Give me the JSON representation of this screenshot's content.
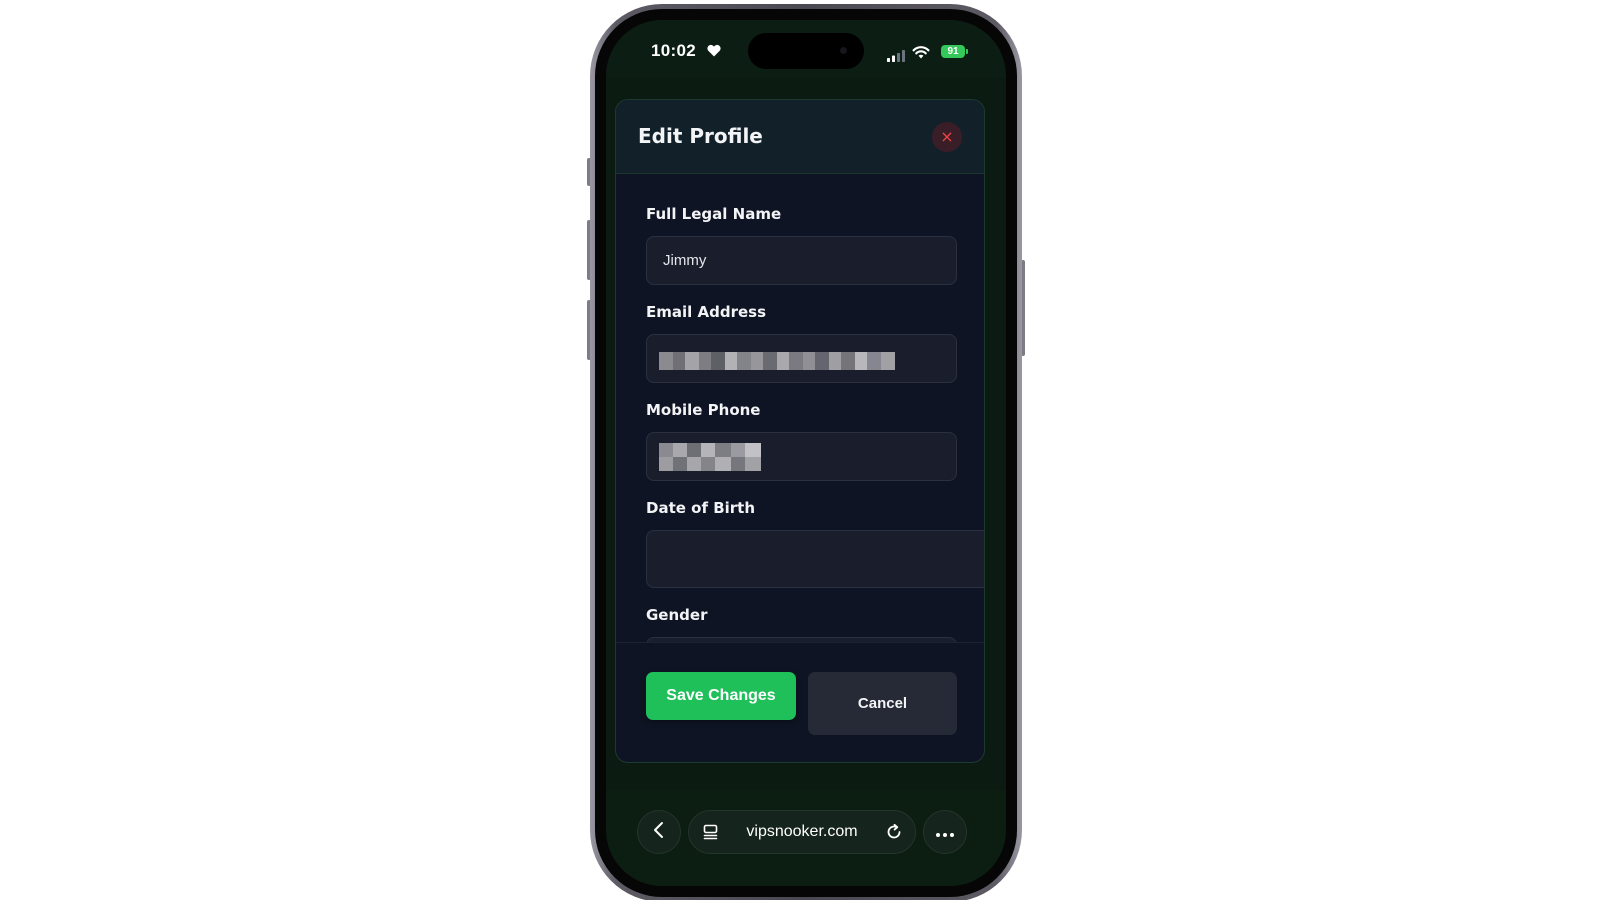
{
  "status_bar": {
    "time": "10:02",
    "battery": "91",
    "icons": [
      "heart-icon",
      "signal-icon",
      "wifi-icon",
      "battery-icon"
    ]
  },
  "modal": {
    "title": "Edit Profile",
    "close_symbol": "×",
    "fields": [
      {
        "label": "Full Legal Name",
        "value": "Jimmy"
      },
      {
        "label": "Email Address",
        "value": ""
      },
      {
        "label": "Mobile Phone",
        "value": ""
      },
      {
        "label": "Date of Birth",
        "value": ""
      },
      {
        "label": "Gender",
        "value": ""
      }
    ],
    "save_label": "Save Changes",
    "cancel_label": "Cancel"
  },
  "browser": {
    "url": "vipsnooker.com",
    "icons": [
      "back-icon",
      "tabs-icon",
      "reload-icon",
      "more-icon"
    ]
  },
  "colors": {
    "accent": "#1fbf5a",
    "close": "#ef4444",
    "modal_bg": "#0f1424",
    "page_bg": "#0b1b12"
  }
}
